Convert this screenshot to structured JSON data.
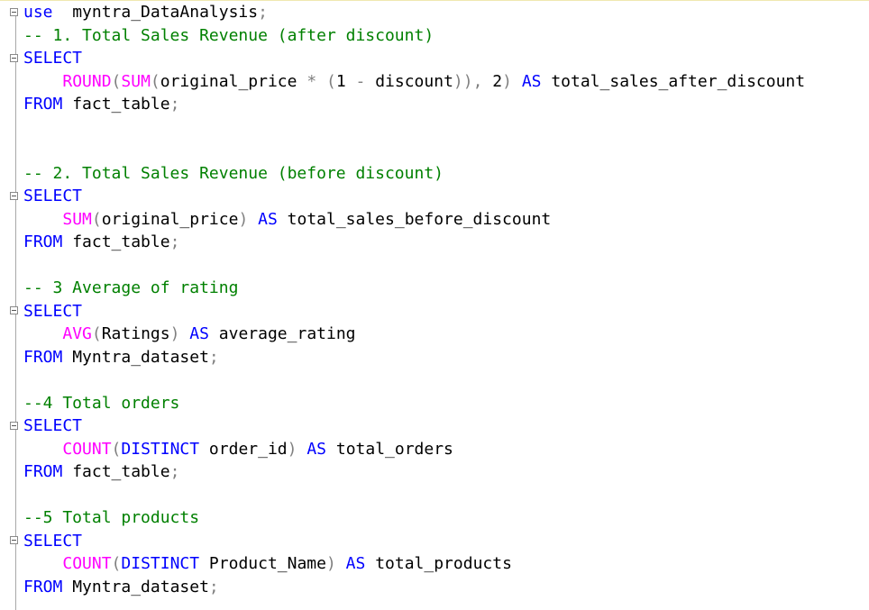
{
  "editor": {
    "lines": [
      {
        "segments": [
          {
            "t": "use",
            "c": "k"
          },
          {
            "t": "  myntra_DataAnalysis",
            "c": "t"
          },
          {
            "t": ";",
            "c": "g"
          }
        ]
      },
      {
        "segments": [
          {
            "t": "-- 1. Total Sales Revenue (after discount)",
            "c": "c"
          }
        ]
      },
      {
        "segments": [
          {
            "t": "SELECT",
            "c": "k"
          }
        ]
      },
      {
        "segments": [
          {
            "t": "    ",
            "c": "t"
          },
          {
            "t": "ROUND",
            "c": "f"
          },
          {
            "t": "(",
            "c": "g"
          },
          {
            "t": "SUM",
            "c": "f"
          },
          {
            "t": "(",
            "c": "g"
          },
          {
            "t": "original_price ",
            "c": "t"
          },
          {
            "t": "*",
            "c": "g"
          },
          {
            "t": " ",
            "c": "t"
          },
          {
            "t": "(",
            "c": "g"
          },
          {
            "t": "1 ",
            "c": "t"
          },
          {
            "t": "-",
            "c": "g"
          },
          {
            "t": " discount",
            "c": "t"
          },
          {
            "t": ")),",
            "c": "g"
          },
          {
            "t": " 2",
            "c": "t"
          },
          {
            "t": ")",
            "c": "g"
          },
          {
            "t": " ",
            "c": "t"
          },
          {
            "t": "AS",
            "c": "k"
          },
          {
            "t": " total_sales_after_discount",
            "c": "t"
          }
        ]
      },
      {
        "segments": [
          {
            "t": "FROM",
            "c": "k"
          },
          {
            "t": " fact_table",
            "c": "t"
          },
          {
            "t": ";",
            "c": "g"
          }
        ]
      },
      {
        "segments": [
          {
            "t": "",
            "c": "t"
          }
        ]
      },
      {
        "segments": [
          {
            "t": "",
            "c": "t"
          }
        ]
      },
      {
        "segments": [
          {
            "t": "-- 2. Total Sales Revenue (before discount)",
            "c": "c"
          }
        ]
      },
      {
        "segments": [
          {
            "t": "SELECT",
            "c": "k"
          }
        ]
      },
      {
        "segments": [
          {
            "t": "    ",
            "c": "t"
          },
          {
            "t": "SUM",
            "c": "f"
          },
          {
            "t": "(",
            "c": "g"
          },
          {
            "t": "original_price",
            "c": "t"
          },
          {
            "t": ")",
            "c": "g"
          },
          {
            "t": " ",
            "c": "t"
          },
          {
            "t": "AS",
            "c": "k"
          },
          {
            "t": " total_sales_before_discount",
            "c": "t"
          }
        ]
      },
      {
        "segments": [
          {
            "t": "FROM",
            "c": "k"
          },
          {
            "t": " fact_table",
            "c": "t"
          },
          {
            "t": ";",
            "c": "g"
          }
        ]
      },
      {
        "segments": [
          {
            "t": "",
            "c": "t"
          }
        ]
      },
      {
        "segments": [
          {
            "t": "-- 3 Average of rating",
            "c": "c"
          }
        ]
      },
      {
        "segments": [
          {
            "t": "SELECT",
            "c": "k"
          }
        ]
      },
      {
        "segments": [
          {
            "t": "    ",
            "c": "t"
          },
          {
            "t": "AVG",
            "c": "f"
          },
          {
            "t": "(",
            "c": "g"
          },
          {
            "t": "Ratings",
            "c": "t"
          },
          {
            "t": ")",
            "c": "g"
          },
          {
            "t": " ",
            "c": "t"
          },
          {
            "t": "AS",
            "c": "k"
          },
          {
            "t": " average_rating",
            "c": "t"
          }
        ]
      },
      {
        "segments": [
          {
            "t": "FROM",
            "c": "k"
          },
          {
            "t": " Myntra_dataset",
            "c": "t"
          },
          {
            "t": ";",
            "c": "g"
          }
        ]
      },
      {
        "segments": [
          {
            "t": "",
            "c": "t"
          }
        ]
      },
      {
        "segments": [
          {
            "t": "--4 Total orders",
            "c": "c"
          }
        ]
      },
      {
        "segments": [
          {
            "t": "SELECT",
            "c": "k"
          }
        ]
      },
      {
        "segments": [
          {
            "t": "    ",
            "c": "t"
          },
          {
            "t": "COUNT",
            "c": "f"
          },
          {
            "t": "(",
            "c": "g"
          },
          {
            "t": "DISTINCT",
            "c": "k"
          },
          {
            "t": " order_id",
            "c": "t"
          },
          {
            "t": ")",
            "c": "g"
          },
          {
            "t": " ",
            "c": "t"
          },
          {
            "t": "AS",
            "c": "k"
          },
          {
            "t": " total_orders",
            "c": "t"
          }
        ]
      },
      {
        "segments": [
          {
            "t": "FROM",
            "c": "k"
          },
          {
            "t": " fact_table",
            "c": "t"
          },
          {
            "t": ";",
            "c": "g"
          }
        ]
      },
      {
        "segments": [
          {
            "t": "",
            "c": "t"
          }
        ]
      },
      {
        "segments": [
          {
            "t": "--5 Total products",
            "c": "c"
          }
        ]
      },
      {
        "segments": [
          {
            "t": "SELECT",
            "c": "k"
          }
        ]
      },
      {
        "segments": [
          {
            "t": "    ",
            "c": "t"
          },
          {
            "t": "COUNT",
            "c": "f"
          },
          {
            "t": "(",
            "c": "g"
          },
          {
            "t": "DISTINCT",
            "c": "k"
          },
          {
            "t": " Product_Name",
            "c": "t"
          },
          {
            "t": ")",
            "c": "g"
          },
          {
            "t": " ",
            "c": "t"
          },
          {
            "t": "AS",
            "c": "k"
          },
          {
            "t": " total_products",
            "c": "t"
          }
        ]
      },
      {
        "segments": [
          {
            "t": "FROM",
            "c": "k"
          },
          {
            "t": " Myntra_dataset",
            "c": "t"
          },
          {
            "t": ";",
            "c": "g"
          }
        ]
      }
    ],
    "fold_markers": [
      0,
      2,
      8,
      13,
      18,
      23
    ]
  },
  "colors": {
    "keyword": "#0000ff",
    "function": "#ff00ff",
    "comment": "#008000",
    "operator": "#808080",
    "text": "#000000"
  },
  "icons": {
    "fold": "collapse-minus-icon"
  }
}
